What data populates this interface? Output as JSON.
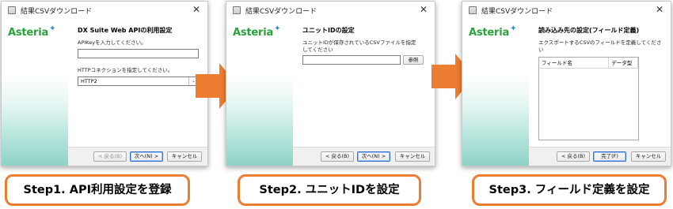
{
  "colors": {
    "accent_orange": "#ed7d31",
    "logo_green": "#2aa13a",
    "logo_star_blue": "#3b86c9"
  },
  "windows": [
    {
      "title": "結果CSVダウンロード",
      "logo": "Asteria",
      "heading": "DX Suite Web APIの利用設定",
      "apikey_label": "APIKeyを入力してください。",
      "apikey_value": "",
      "http_label": "HTTPコネクションを指定してください。",
      "http_value": "HTTP2",
      "buttons": {
        "back": "< 戻る(B)",
        "next": "次へ(N) >",
        "cancel": "キャンセル"
      }
    },
    {
      "title": "結果CSVダウンロード",
      "logo": "Asteria",
      "heading": "ユニットIDの設定",
      "instruction_line1": "ユニットIDが保存されているCSVファイルを指定",
      "instruction_line2": "してください",
      "file_value": "",
      "browse": "参照",
      "buttons": {
        "back": "< 戻る(B)",
        "next": "次へ(N) >",
        "cancel": "キャンセル"
      }
    },
    {
      "title": "結果CSVダウンロード",
      "logo": "Asteria",
      "heading": "読み込み先の設定(フィールド定義)",
      "instruction_line1": "エクスポートするCSVのフィールドを定義してくださ",
      "instruction_line2": "い",
      "columns": [
        "フィールド名",
        "データ型"
      ],
      "buttons": {
        "back": "< 戻る(B)",
        "finish": "完了(F)",
        "cancel": "キャンセル"
      }
    }
  ],
  "steps": [
    "Step1.  API利用設定を登録",
    "Step2. ユニットIDを設定",
    "Step3. フィールド定義を設定"
  ]
}
